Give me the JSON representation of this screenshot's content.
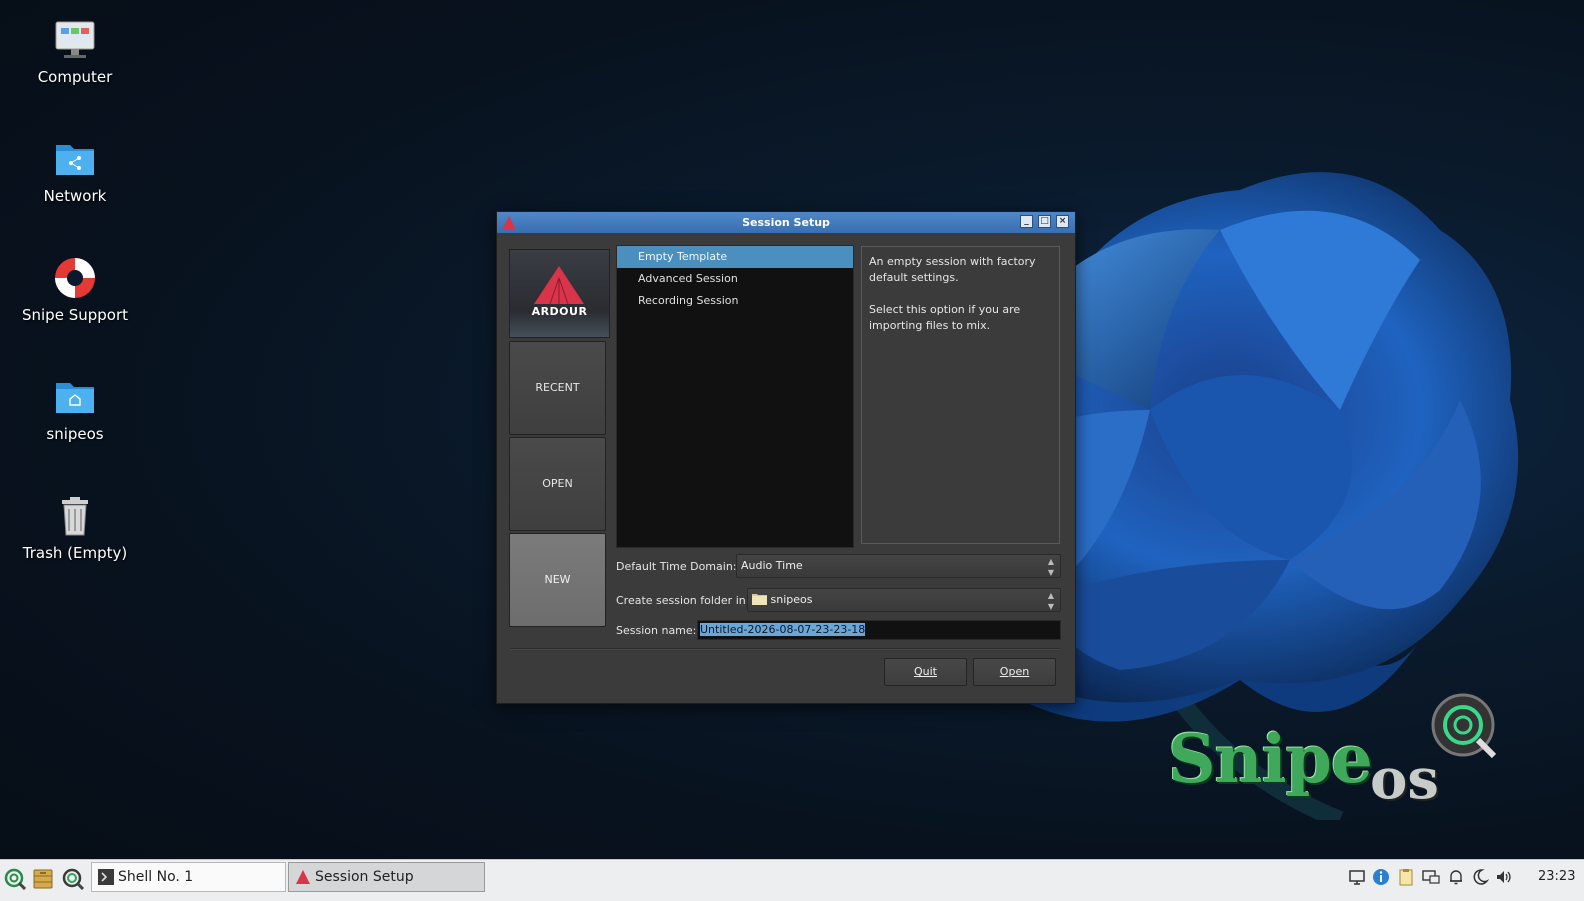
{
  "desktop": {
    "icons": [
      {
        "label": "Computer"
      },
      {
        "label": "Network"
      },
      {
        "label": "Snipe Support"
      },
      {
        "label": "snipeos"
      },
      {
        "label": "Trash (Empty)"
      }
    ],
    "wallpaper_logo": {
      "main": "Snipe",
      "suffix": "os"
    }
  },
  "dialog": {
    "title": "Session Setup",
    "logo_text": "ARDOUR",
    "side_buttons": [
      "RECENT",
      "OPEN",
      "NEW"
    ],
    "templates": [
      "Empty Template",
      "Advanced Session",
      "Recording Session"
    ],
    "selected_template_index": 0,
    "description": [
      "An empty session with factory default settings.",
      "Select this option if you are importing files to mix."
    ],
    "time_domain_label": "Default Time Domain:",
    "time_domain_value": "Audio Time",
    "folder_label": "Create session folder in:",
    "folder_value": "snipeos",
    "session_name_label": "Session name:",
    "session_name_value": "Untitled-2026-08-07-23-23-18",
    "quit_label": "Quit",
    "open_label": "Open"
  },
  "taskbar": {
    "tasks": [
      {
        "label": "Shell No. 1",
        "active": false
      },
      {
        "label": "Session Setup",
        "active": true
      }
    ],
    "clock": "23:23"
  },
  "colors": {
    "accent": "#4a8fbd",
    "titlebar": "#4f87c8",
    "ardour_red": "#d9344a"
  }
}
